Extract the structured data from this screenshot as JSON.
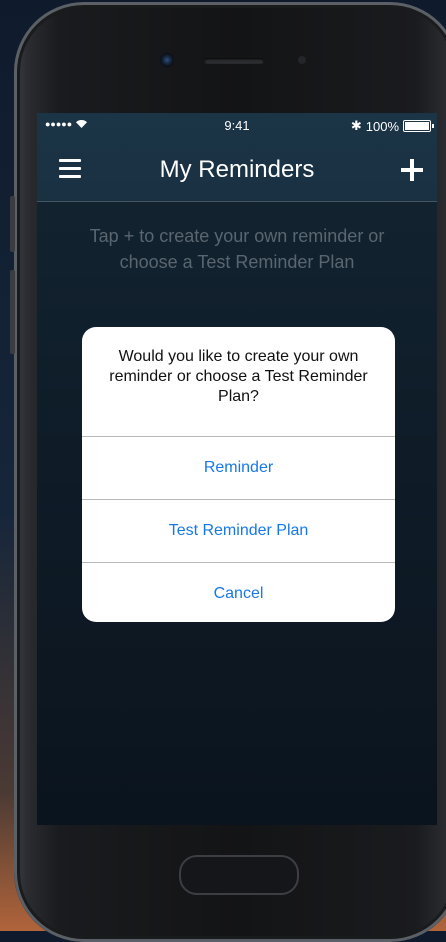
{
  "status_bar": {
    "signal": "●●●●●",
    "wifi_icon": "wifi-icon",
    "time": "9:41",
    "bluetooth": "✱",
    "battery_text": "100%"
  },
  "nav": {
    "menu_icon": "menu-icon",
    "title": "My Reminders",
    "add_icon": "add-icon"
  },
  "hint": "Tap + to create your own reminder or choose a Test Reminder Plan",
  "alert": {
    "message": "Would you like to create your own reminder or choose a Test Reminder Plan?",
    "buttons": [
      "Reminder",
      "Test Reminder Plan",
      "Cancel"
    ]
  },
  "colors": {
    "accent": "#1778e8",
    "screen_bg": "#16293a",
    "hint_text": "#7c8e9c"
  }
}
